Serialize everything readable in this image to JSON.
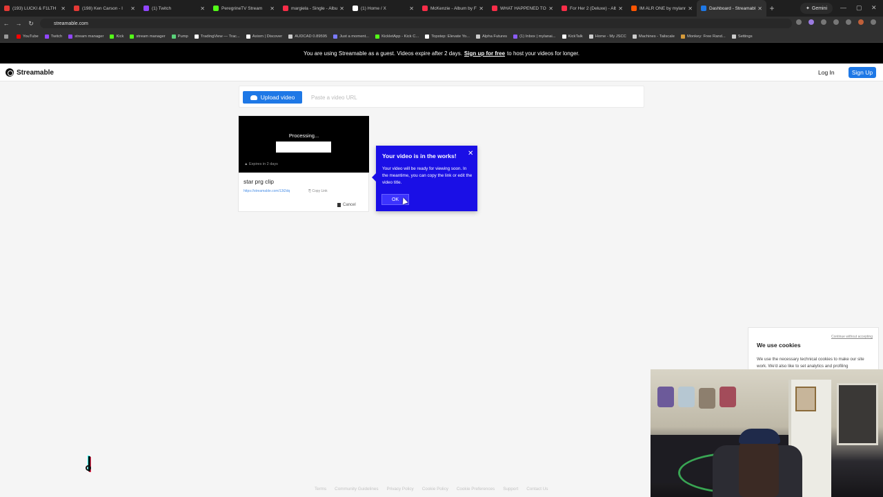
{
  "browser": {
    "tabs": [
      {
        "label": "(193) LUCKI & F1LTH",
        "color": "#e53935"
      },
      {
        "label": "(198) Ken Carson - I",
        "color": "#e53935"
      },
      {
        "label": "(1) Twitch",
        "color": "#9146ff"
      },
      {
        "label": "PeregrineTV Stream",
        "color": "#53fc18"
      },
      {
        "label": "margiela - Single - Album",
        "color": "#fa2d48"
      },
      {
        "label": "(1) Home / X",
        "color": "#ffffff"
      },
      {
        "label": "McKenzie - Album by Fr",
        "color": "#fa2d48"
      },
      {
        "label": "WHAT HAPPENED TO TH",
        "color": "#fa2d48"
      },
      {
        "label": "For Her 2 (Deluxe) - Alb",
        "color": "#fa2d48"
      },
      {
        "label": "IM ALR ONE by mylann",
        "color": "#ff5500"
      },
      {
        "label": "Dashboard - Streamable",
        "color": "#1e78e6",
        "active": true
      }
    ],
    "gemini_label": "Gemini",
    "url": "streamable.com",
    "bookmarks": [
      {
        "label": "YouTube",
        "color": "#ff0000"
      },
      {
        "label": "Twitch",
        "color": "#9146ff"
      },
      {
        "label": "stream manager",
        "color": "#9146ff"
      },
      {
        "label": "Kick",
        "color": "#53fc18"
      },
      {
        "label": "stream manager",
        "color": "#53fc18"
      },
      {
        "label": "Pump",
        "color": "#5ad17a"
      },
      {
        "label": "TradingView — Trac...",
        "color": "#ffffff"
      },
      {
        "label": "Axiom | Discover",
        "color": "#ffffff"
      },
      {
        "label": "AUDCAD 0.89595",
        "color": "#cccccc"
      },
      {
        "label": "Just a moment...",
        "color": "#7a7aff"
      },
      {
        "label": "KickletApp - Kick C...",
        "color": "#53fc18"
      },
      {
        "label": "Topstep: Elevate Yo...",
        "color": "#ffffff"
      },
      {
        "label": "Alpha Futures",
        "color": "#cccccc"
      },
      {
        "label": "(1) Inbox | mylanai...",
        "color": "#8a5cf5"
      },
      {
        "label": "KickTalk",
        "color": "#ffffff"
      },
      {
        "label": "Home - My JSCC",
        "color": "#cccccc"
      },
      {
        "label": "Machines - Tailscale",
        "color": "#cccccc"
      },
      {
        "label": "Monkey: Free Rand...",
        "color": "#d59a3a"
      },
      {
        "label": "Settings",
        "color": "#cccccc"
      }
    ]
  },
  "banner": {
    "prefix": "You are using Streamable as a guest. Videos expire after 2 days.",
    "link": "Sign up for free",
    "suffix": "to host your videos for longer."
  },
  "header": {
    "logo": "Streamable",
    "login": "Log In",
    "signup": "Sign Up"
  },
  "upload": {
    "button": "Upload video",
    "url_placeholder": "Paste a video URL"
  },
  "video_card": {
    "status": "Processing...",
    "progress": 1.0,
    "expires": "Expires in 2 days",
    "title": "star prg clip",
    "link": "https://streamable.com/13t2dq",
    "copy_link": "Copy Link",
    "cancel": "Cancel"
  },
  "popup": {
    "title": "Your video is in the works!",
    "body": "Your video will be ready for viewing soon. In the meantime, you can copy the link or edit the video title.",
    "ok": "OK"
  },
  "cookie": {
    "continue": "Continue without accepting",
    "title": "We use cookies",
    "body": "We use the necessary technical cookies to make our site work. We'd also like to set analytics and profiling"
  },
  "footer": {
    "links": [
      "Terms",
      "Community Guidelines",
      "Privacy Policy",
      "Cookie Policy",
      "Cookie Preferences",
      "Support",
      "Contact Us"
    ]
  }
}
